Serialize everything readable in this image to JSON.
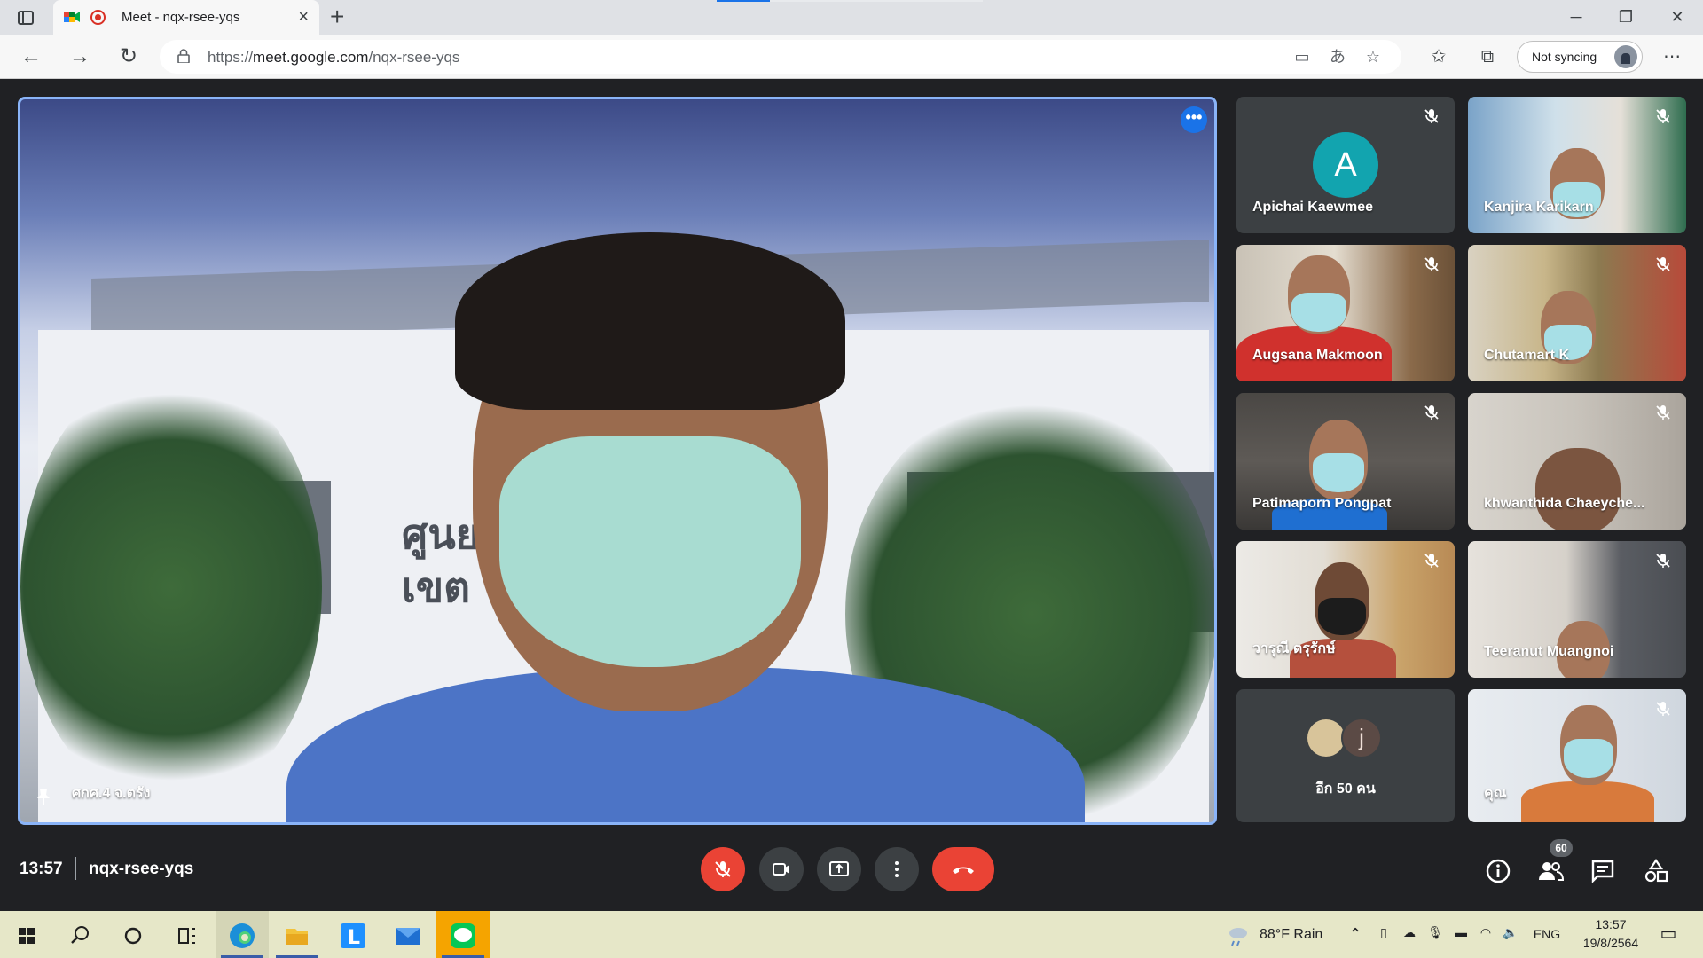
{
  "browser": {
    "tab_title": "Meet - nqx-rsee-yqs",
    "url_prefix": "https://",
    "url_host": "meet.google.com",
    "url_path": "/nqx-rsee-yqs",
    "sync_label": "Not syncing",
    "new_tab_glyph": "+",
    "close_glyph": "×"
  },
  "meet": {
    "main_speaker": "ศกศ.4 จ.ตรัง",
    "sign_text": "ศูนย\nเขต",
    "participants": [
      {
        "name": "Apichai Kaewmee",
        "avatar_letter": "A",
        "mic": "muted"
      },
      {
        "name": "Kanjira Karikarn",
        "mic": "muted"
      },
      {
        "name": "Augsana Makmoon",
        "mic": "muted"
      },
      {
        "name": "Chutamart K",
        "mic": "muted"
      },
      {
        "name": "Patimaporn Pongpat",
        "mic": "muted"
      },
      {
        "name": "khwanthida Chaeyche...",
        "mic": "muted"
      },
      {
        "name": "วารุณี ตรุรักษ์",
        "mic": "muted"
      },
      {
        "name": "Teeranut Muangnoi",
        "mic": "muted"
      },
      {
        "name": "คุณ",
        "mic": "muted"
      }
    ],
    "more_tile": {
      "avatar_letter": "j",
      "label": "อีก 50 คน"
    },
    "time": "13:57",
    "meeting_code": "nqx-rsee-yqs",
    "participant_count": "60"
  },
  "taskbar": {
    "weather": "88°F  Rain",
    "language": "ENG",
    "clock_time": "13:57",
    "clock_date": "19/8/2564"
  },
  "colors": {
    "meet_bg": "#202124",
    "active_border": "#8ab4f8",
    "danger_red": "#ea4335",
    "avatar_teal": "#12a4af",
    "tile_bg": "#3c4043",
    "taskbar_bg": "#e6e7c8"
  }
}
